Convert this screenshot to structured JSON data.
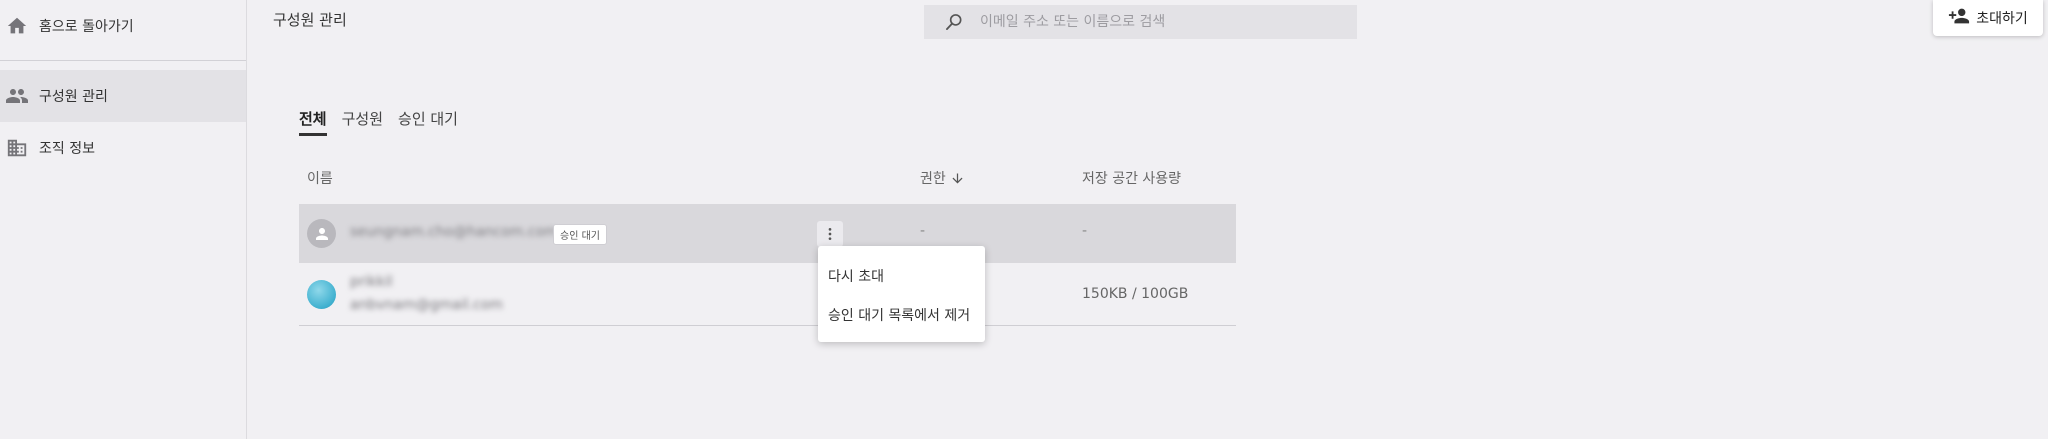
{
  "sidebar": {
    "home_label": "홈으로 돌아가기",
    "items": [
      {
        "label": "구성원 관리",
        "icon": "people-icon",
        "active": true
      },
      {
        "label": "조직 정보",
        "icon": "building-icon",
        "active": false
      }
    ]
  },
  "header": {
    "title": "구성원 관리",
    "search_placeholder": "이메일 주소 또는 이름으로 검색",
    "invite_label": "초대하기"
  },
  "tabs": [
    {
      "label": "전체",
      "active": true
    },
    {
      "label": "구성원",
      "active": false
    },
    {
      "label": "승인 대기",
      "active": false
    }
  ],
  "table": {
    "columns": [
      "이름",
      "권한",
      "저장 공간 사용량"
    ],
    "rows": [
      {
        "email": "seungnam.cho@hancom.com",
        "badge": "승인 대기",
        "role": "-",
        "storage": "-"
      },
      {
        "name": "prikkil",
        "email": "anbvnam@gmail.com",
        "storage": "150KB / 100GB"
      }
    ]
  },
  "context_menu": {
    "items": [
      "다시 초대",
      "승인 대기 목록에서 제거"
    ]
  },
  "colors": {
    "background": "#f1f0f3",
    "selected_row": "#d9d8dc",
    "search_bg": "#e3e2e6"
  }
}
